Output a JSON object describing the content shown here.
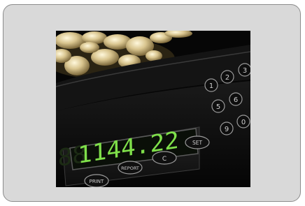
{
  "photo": {
    "display_value": "1144.22",
    "buttons": {
      "print": "PRINT",
      "report": "REPORT",
      "c": "C",
      "set": "SET"
    },
    "keypad": [
      "1",
      "2",
      "3",
      "5",
      "6",
      "9",
      "0"
    ],
    "colors": {
      "frame": "#d9d9d9",
      "frame_border": "#8c8c8c",
      "display_green": "#7fe04a",
      "machine": "#101010"
    }
  }
}
